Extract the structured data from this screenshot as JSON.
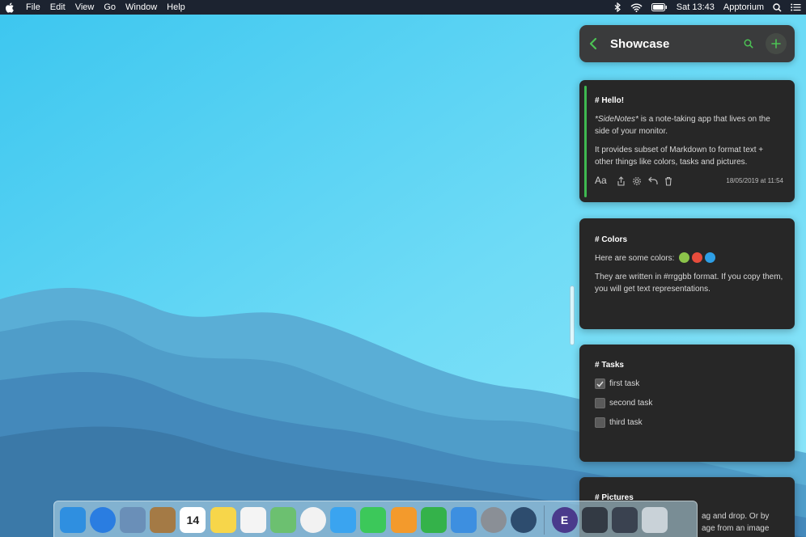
{
  "menubar": {
    "items": [
      "File",
      "Edit",
      "View",
      "Go",
      "Window",
      "Help"
    ],
    "clock": "Sat 13:43",
    "user": "Apptorium"
  },
  "sidenotes": {
    "folder_title": "Showcase",
    "accent_color": "#4cc354",
    "notes": [
      {
        "heading": "# Hello!",
        "p1_italic": "*SideNotes*",
        "p1_rest": " is a note-taking app that lives on the side of your monitor.",
        "p2": "It provides subset of Markdown to format text + other things like colors, tasks and pictures.",
        "toolbar_aa": "Aa",
        "timestamp": "18/05/2019 at 11:54"
      },
      {
        "heading": "# Colors",
        "line1": "Here are some colors:",
        "colors": [
          "#8bc34a",
          "#e74c3c",
          "#2e9fe6"
        ],
        "line2": "They are written in #rrggbb format. If you copy them, you will get text representations."
      },
      {
        "heading": "# Tasks",
        "tasks": [
          {
            "label": "first task",
            "done": true
          },
          {
            "label": "second task",
            "done": false
          },
          {
            "label": "third task",
            "done": false
          }
        ]
      },
      {
        "heading": "# Pictures",
        "line1": "ag and drop. Or by",
        "line2": "age from an image"
      }
    ]
  },
  "dock": {
    "apps": [
      {
        "name": "finder-icon",
        "glyph": "",
        "color": "#2f8fe0"
      },
      {
        "name": "safari-icon",
        "glyph": "",
        "color": "#2a7de1"
      },
      {
        "name": "preview-icon",
        "glyph": "",
        "color": "#6a8fb8"
      },
      {
        "name": "notefile-icon",
        "glyph": "",
        "color": "#a47a45"
      },
      {
        "name": "calendar-icon",
        "glyph": "14",
        "color": "#ffffff"
      },
      {
        "name": "notes-icon",
        "glyph": "",
        "color": "#f7d64a"
      },
      {
        "name": "reminders-icon",
        "glyph": "",
        "color": "#f4f4f4"
      },
      {
        "name": "maps-icon",
        "glyph": "",
        "color": "#6cc070"
      },
      {
        "name": "photos-icon",
        "glyph": "",
        "color": "#f2f2f2"
      },
      {
        "name": "messages-icon",
        "glyph": "",
        "color": "#3aa4f0"
      },
      {
        "name": "facetime-icon",
        "glyph": "",
        "color": "#3cc85a"
      },
      {
        "name": "pages-icon",
        "glyph": "",
        "color": "#f39a2c"
      },
      {
        "name": "numbers-icon",
        "glyph": "",
        "color": "#34b24a"
      },
      {
        "name": "keynote-icon",
        "glyph": "",
        "color": "#3d8fe0"
      },
      {
        "name": "system-preferences-icon",
        "glyph": "",
        "color": "#8a8f96"
      },
      {
        "name": "quicktime-icon",
        "glyph": "",
        "color": "#2d4c6e"
      }
    ],
    "right_apps": [
      {
        "name": "e-app-icon",
        "glyph": "E",
        "color": "#4a3a8c"
      },
      {
        "name": "window-thumbnail-1",
        "glyph": "",
        "color": "#333a44"
      },
      {
        "name": "window-thumbnail-2",
        "glyph": "",
        "color": "#3a4250"
      },
      {
        "name": "trash-icon",
        "glyph": "",
        "color": "#c9d2d8"
      }
    ]
  }
}
